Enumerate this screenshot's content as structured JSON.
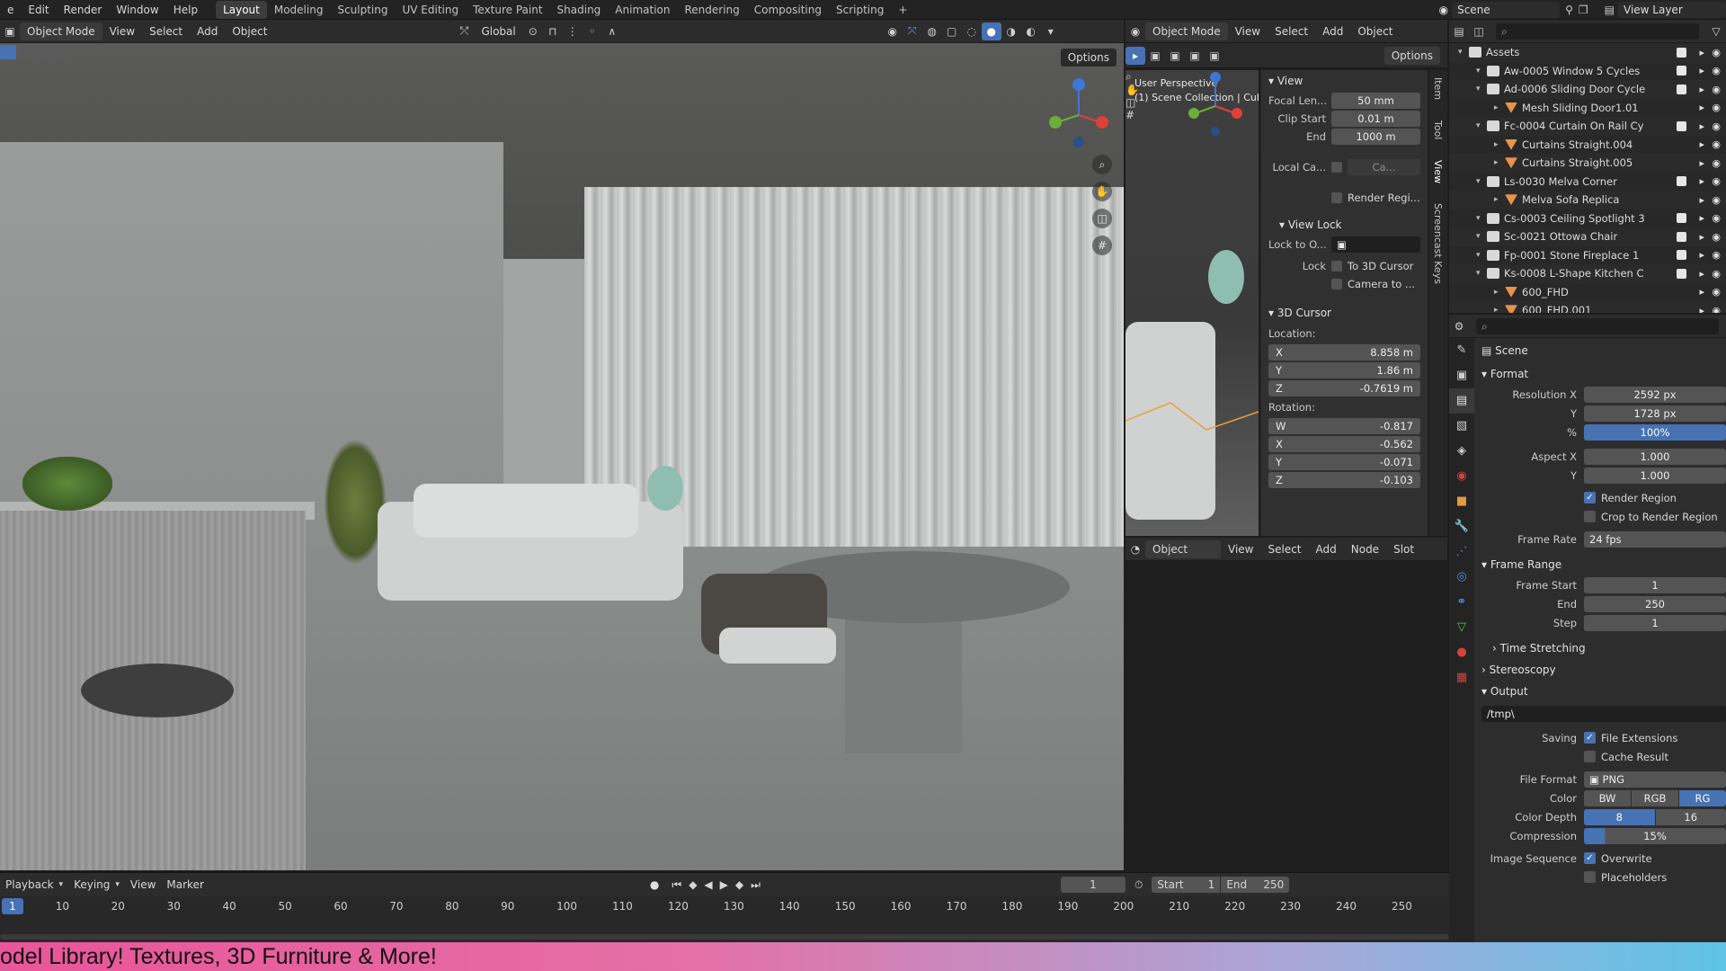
{
  "topbar": {
    "menus": [
      "e",
      "Edit",
      "Render",
      "Window",
      "Help"
    ],
    "workspaces": [
      "Layout",
      "Modeling",
      "Sculpting",
      "UV Editing",
      "Texture Paint",
      "Shading",
      "Animation",
      "Rendering",
      "Compositing",
      "Scripting"
    ],
    "active_workspace": "Layout",
    "scene_label": "Scene",
    "view_layer_label": "View Layer"
  },
  "viewport": {
    "mode": "Object Mode",
    "menus": [
      "View",
      "Select",
      "Add",
      "Object"
    ],
    "transform": "Global",
    "options": "Options"
  },
  "subviewport": {
    "mode": "Object Mode",
    "menus": [
      "View",
      "Select",
      "Add",
      "Object"
    ],
    "options": "Options",
    "overlay_line1": "User Perspective",
    "overlay_line2": "(1) Scene Collection | Cub"
  },
  "npanel": {
    "tabs": [
      "Item",
      "Tool",
      "View",
      "Screencast Keys"
    ],
    "view_header": "View",
    "focal_length_label": "Focal Len...",
    "focal_length": "50 mm",
    "clip_start_label": "Clip Start",
    "clip_start": "0.01 m",
    "clip_end_label": "End",
    "clip_end": "1000 m",
    "local_camera_label": "Local Ca...",
    "local_camera_value": "Ca...",
    "render_region": "Render Regi...",
    "view_lock_header": "View Lock",
    "lock_to_object_label": "Lock to O...",
    "lock_label": "Lock",
    "to_3d_cursor": "To 3D Cursor",
    "camera_to": "Camera to ...",
    "cursor_header": "3D Cursor",
    "location_label": "Location:",
    "loc_x": "8.858 m",
    "loc_y": "1.86 m",
    "loc_z": "-0.7619 m",
    "rotation_label": "Rotation:",
    "rot_w": "-0.817",
    "rot_x": "-0.562",
    "rot_y": "-0.071",
    "rot_z": "-0.103",
    "axis_x": "X",
    "axis_y": "Y",
    "axis_z": "Z",
    "axis_w": "W"
  },
  "node_editor": {
    "mode": "Object",
    "menus": [
      "View",
      "Select",
      "Add",
      "Node"
    ],
    "slot": "Slot"
  },
  "outliner": {
    "items": [
      {
        "name": "Assets",
        "indent": 0,
        "type": "collection"
      },
      {
        "name": "Aw-0005 Window 5 Cycles",
        "indent": 1,
        "type": "collection"
      },
      {
        "name": "Ad-0006 Sliding Door Cycle",
        "indent": 1,
        "type": "collection"
      },
      {
        "name": "Mesh Sliding Door1.01",
        "indent": 2,
        "type": "mesh"
      },
      {
        "name": "Fc-0004 Curtain On Rail Cy",
        "indent": 1,
        "type": "collection"
      },
      {
        "name": "Curtains Straight.004",
        "indent": 2,
        "type": "mesh"
      },
      {
        "name": "Curtains Straight.005",
        "indent": 2,
        "type": "mesh"
      },
      {
        "name": "Ls-0030 Melva Corner",
        "indent": 1,
        "type": "collection"
      },
      {
        "name": "Melva Sofa Replica",
        "indent": 2,
        "type": "mesh"
      },
      {
        "name": "Cs-0003 Ceiling Spotlight 3",
        "indent": 1,
        "type": "collection"
      },
      {
        "name": "Sc-0021 Ottowa Chair",
        "indent": 1,
        "type": "collection"
      },
      {
        "name": "Fp-0001 Stone Fireplace 1",
        "indent": 1,
        "type": "collection"
      },
      {
        "name": "Ks-0008 L-Shape Kitchen C",
        "indent": 1,
        "type": "collection"
      },
      {
        "name": "600_FHD",
        "indent": 2,
        "type": "mesh"
      },
      {
        "name": "600_FHD.001",
        "indent": 2,
        "type": "mesh"
      }
    ]
  },
  "properties": {
    "scene_label": "Scene",
    "format_header": "Format",
    "resolution_x_label": "Resolution X",
    "resolution_x": "2592 px",
    "resolution_y_label": "Y",
    "resolution_y": "1728 px",
    "percent_label": "%",
    "percent": "100%",
    "aspect_x_label": "Aspect X",
    "aspect_x": "1.000",
    "aspect_y_label": "Y",
    "aspect_y": "1.000",
    "render_region": "Render Region",
    "crop_to_region": "Crop to Render Region",
    "frame_rate_label": "Frame Rate",
    "frame_rate": "24 fps",
    "frame_range_header": "Frame Range",
    "frame_start_label": "Frame Start",
    "frame_start": "1",
    "end_label": "End",
    "end": "250",
    "step_label": "Step",
    "step": "1",
    "time_stretching": "Time Stretching",
    "stereoscopy": "Stereoscopy",
    "output_header": "Output",
    "output_path": "/tmp\\",
    "saving_label": "Saving",
    "file_extensions": "File Extensions",
    "cache_result": "Cache Result",
    "file_format_label": "File Format",
    "file_format": "PNG",
    "color_label": "Color",
    "color_bw": "BW",
    "color_rgb": "RGB",
    "color_rgba": "RG",
    "color_depth_label": "Color Depth",
    "color_depth_8": "8",
    "color_depth_16": "16",
    "compression_label": "Compression",
    "compression": "15%",
    "image_sequence_label": "Image Sequence",
    "overwrite": "Overwrite",
    "placeholders": "Placeholders"
  },
  "timeline": {
    "menus": [
      "Playback",
      "Keying",
      "View",
      "Marker"
    ],
    "current_frame": "1",
    "start_label": "Start",
    "start": "1",
    "end_label": "End",
    "end": "250",
    "ticks": [
      "1",
      "10",
      "20",
      "30",
      "40",
      "50",
      "60",
      "70",
      "80",
      "90",
      "100",
      "110",
      "120",
      "130",
      "140",
      "150",
      "160",
      "170",
      "180",
      "190",
      "200",
      "210",
      "220",
      "230",
      "240",
      "250"
    ]
  },
  "banner": {
    "text": "odel Library! Textures, 3D Furniture & More!"
  },
  "colors": {
    "accent": "#4772b3",
    "gizmo_x": "#e0403a",
    "gizmo_y": "#6cae3a",
    "gizmo_z": "#3f76d3"
  }
}
